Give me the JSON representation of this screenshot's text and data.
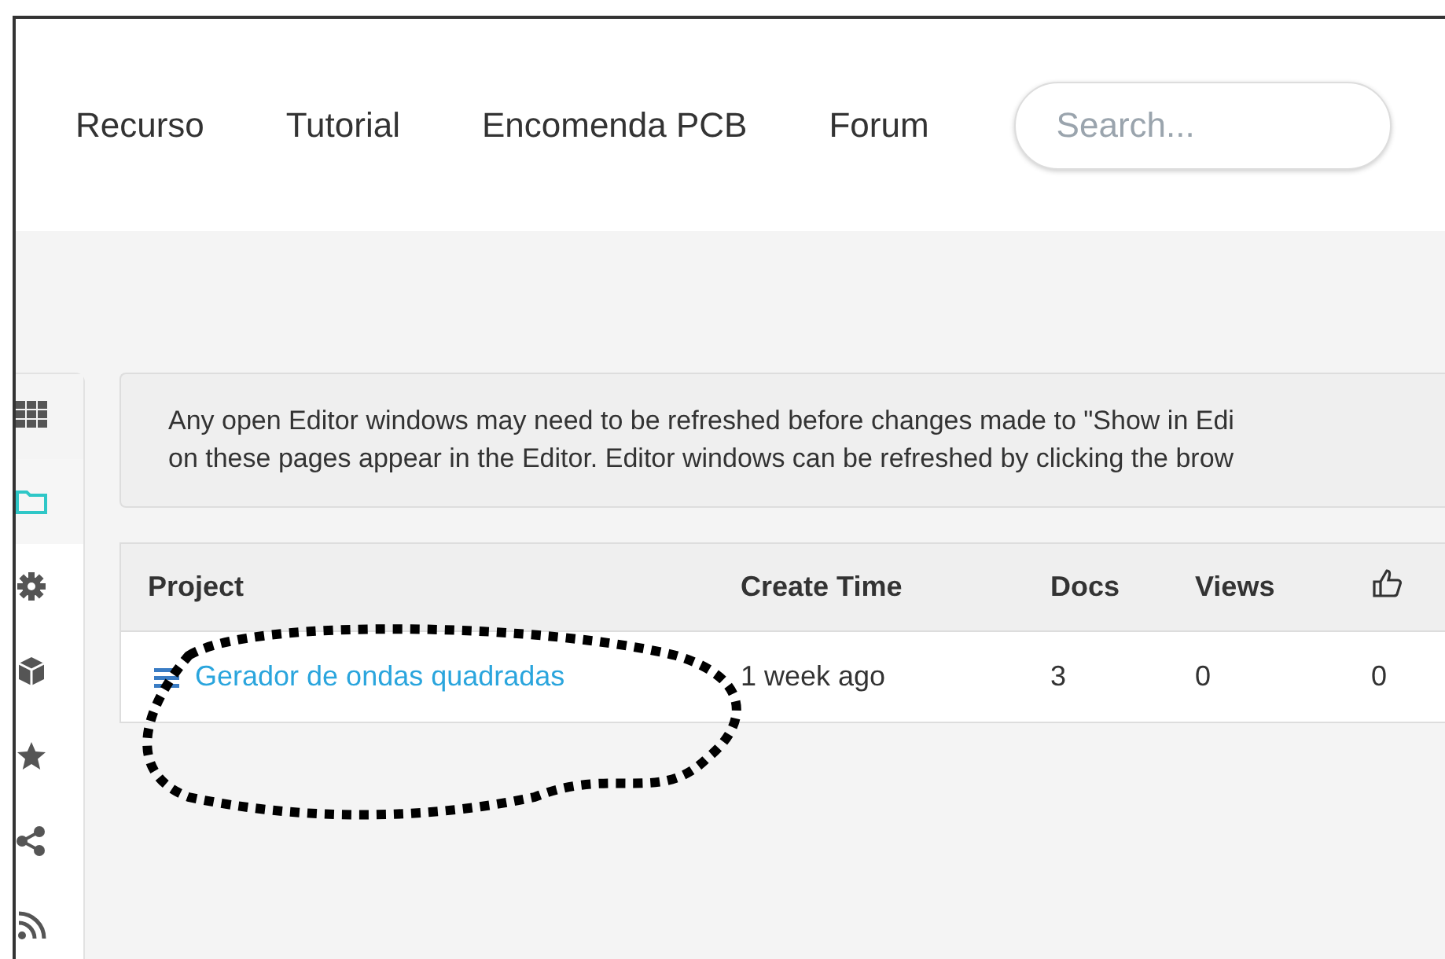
{
  "nav": {
    "links": [
      "Recurso",
      "Tutorial",
      "Encomenda PCB",
      "Forum"
    ],
    "search": {
      "placeholder": "Search..."
    }
  },
  "sidebar": {
    "items": [
      {
        "kind": "grid",
        "selected": false
      },
      {
        "kind": "folder",
        "selected": true
      },
      {
        "kind": "gear",
        "selected": false
      },
      {
        "kind": "cube",
        "selected": false
      },
      {
        "kind": "star",
        "selected": false
      },
      {
        "kind": "share",
        "selected": false
      },
      {
        "kind": "rss",
        "selected": false
      }
    ]
  },
  "notice": {
    "lines": [
      "Any open Editor windows may need to be refreshed before changes made to \"Show in Edi",
      "on these pages appear in the Editor. Editor windows can be refreshed by clicking the brow"
    ]
  },
  "table": {
    "columns": [
      {
        "kind": "text",
        "label": "Project"
      },
      {
        "kind": "text",
        "label": "Create Time"
      },
      {
        "kind": "text",
        "label": "Docs"
      },
      {
        "kind": "text",
        "label": "Views"
      },
      {
        "kind": "likes"
      }
    ],
    "rows": [
      {
        "cells": [
          "Gerador de ondas quadradas",
          "1 week ago",
          "3",
          "0",
          "0"
        ]
      }
    ]
  },
  "annotation": {
    "kind": "dotted-ellipse"
  }
}
